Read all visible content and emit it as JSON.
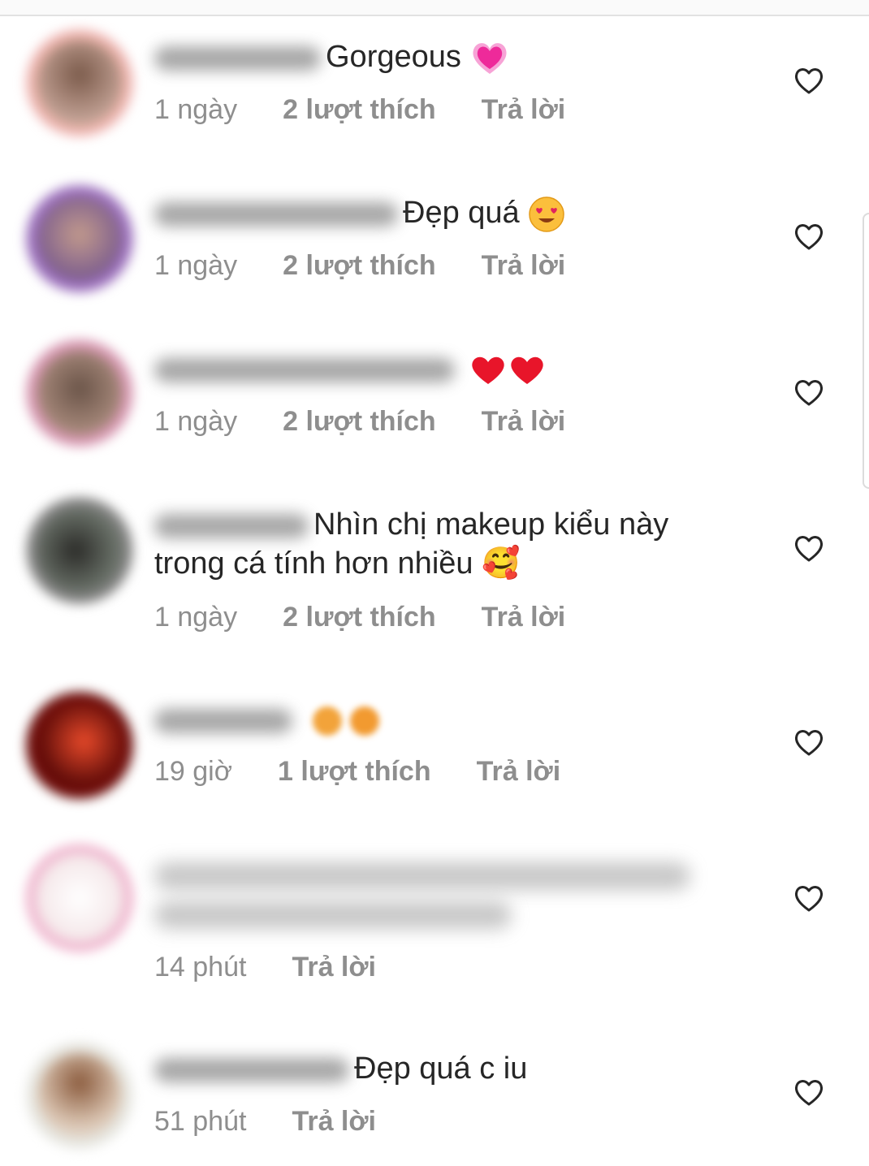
{
  "comments": [
    {
      "text": "Gorgeous",
      "emoji": "growing-heart-emoji",
      "time": "1 ngày",
      "likes": "2 lượt thích",
      "reply": "Trả lời"
    },
    {
      "text": "Đẹp quá",
      "emoji": "heart-eyes-emoji",
      "time": "1 ngày",
      "likes": "2 lượt thích",
      "reply": "Trả lời"
    },
    {
      "text": "",
      "emoji": "red-hearts-emoji",
      "time": "1 ngày",
      "likes": "2 lượt thích",
      "reply": "Trả lời"
    },
    {
      "text": "Nhìn chị makeup kiểu này",
      "text2": "trong cá tính hơn nhiều 🥰",
      "time": "1 ngày",
      "likes": "2 lượt thích",
      "reply": "Trả lời"
    },
    {
      "text": "",
      "emoji": "blurred-emoji",
      "time": "19 giờ",
      "likes": "1 lượt thích",
      "reply": "Trả lời"
    },
    {
      "text": "",
      "time": "14 phút",
      "reply": "Trả lời"
    },
    {
      "text": "Đẹp quá c iu",
      "time": "51 phút",
      "reply": "Trả lời"
    }
  ],
  "icons": {
    "like": "heart-outline-icon"
  },
  "colors": {
    "text": "#262626",
    "meta": "#8e8e8e",
    "background": "#ffffff"
  }
}
